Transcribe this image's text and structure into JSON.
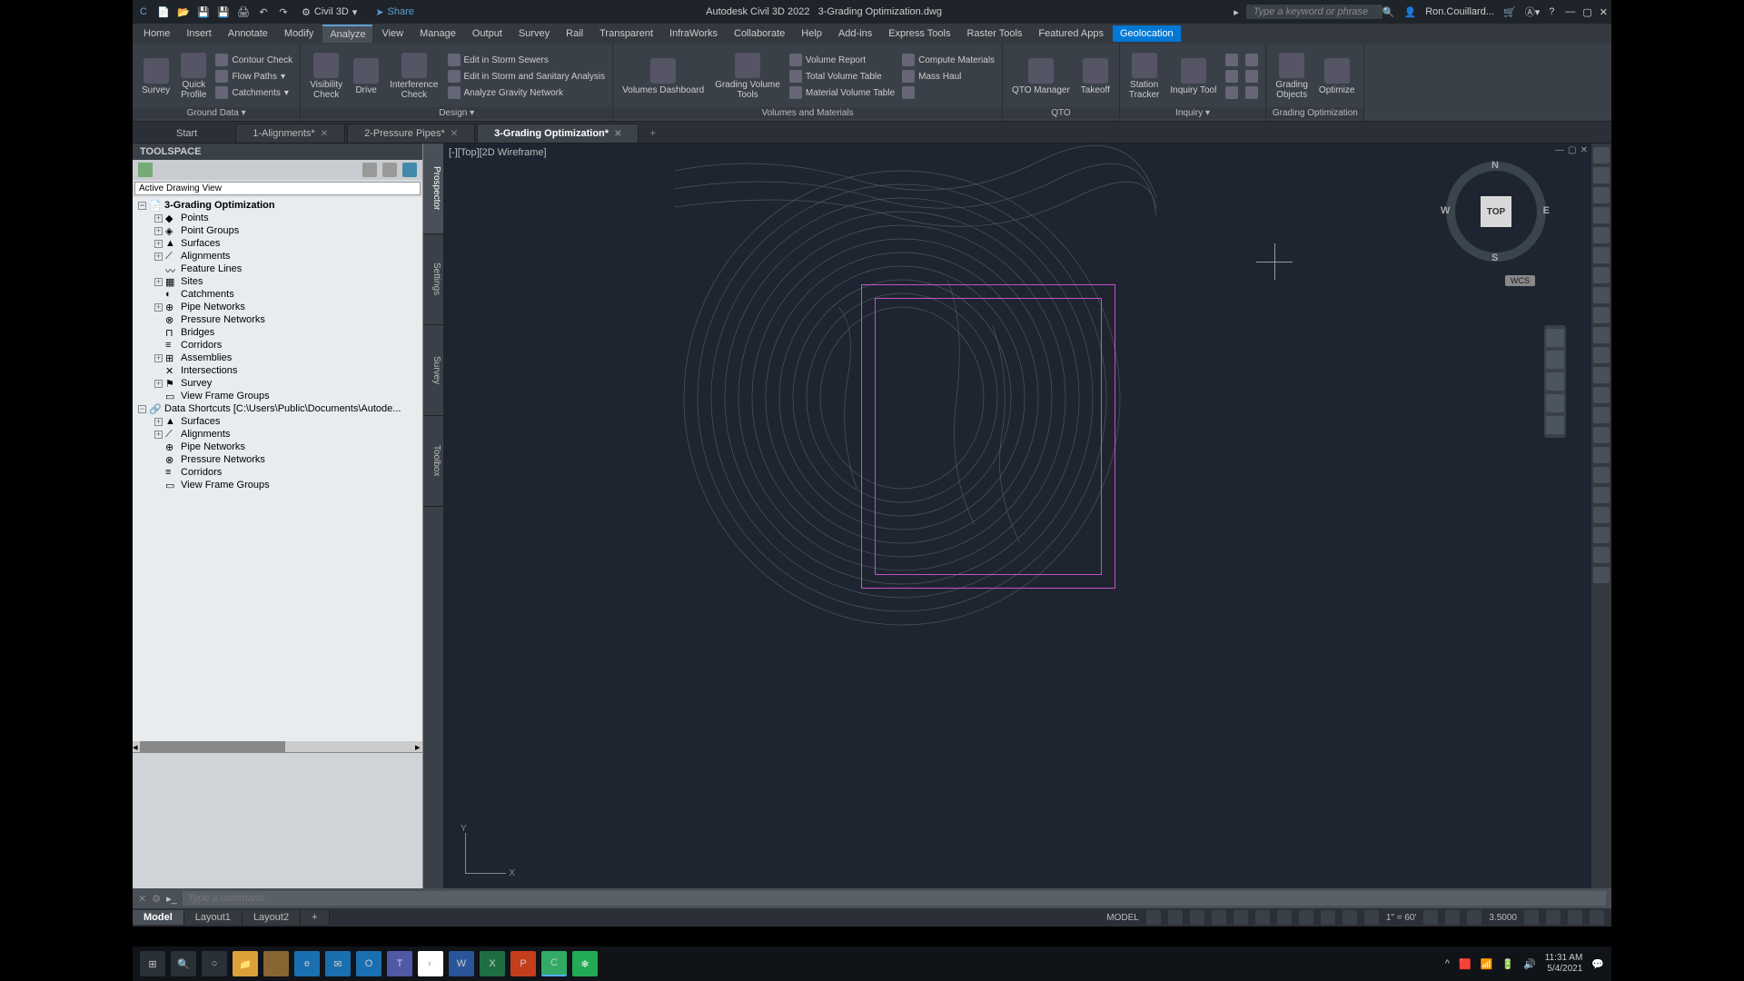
{
  "titlebar": {
    "workspace": "Civil 3D",
    "share": "Share",
    "app_title": "Autodesk Civil 3D 2022",
    "doc_title": "3-Grading Optimization.dwg",
    "search_placeholder": "Type a keyword or phrase",
    "user": "Ron.Couillard..."
  },
  "menubar": {
    "tabs": [
      {
        "label": "Home"
      },
      {
        "label": "Insert"
      },
      {
        "label": "Annotate"
      },
      {
        "label": "Modify"
      },
      {
        "label": "Analyze",
        "active": true
      },
      {
        "label": "View"
      },
      {
        "label": "Manage"
      },
      {
        "label": "Output"
      },
      {
        "label": "Survey"
      },
      {
        "label": "Rail"
      },
      {
        "label": "Transparent"
      },
      {
        "label": "InfraWorks"
      },
      {
        "label": "Collaborate"
      },
      {
        "label": "Help"
      },
      {
        "label": "Add-ins"
      },
      {
        "label": "Express Tools"
      },
      {
        "label": "Raster Tools"
      },
      {
        "label": "Featured Apps"
      },
      {
        "label": "Geolocation",
        "geo": true
      }
    ]
  },
  "ribbon": {
    "ground_data": {
      "survey": "Survey",
      "quick_profile": "Quick\nProfile",
      "contour_check": "Contour Check",
      "flow_paths": "Flow Paths",
      "catchments": "Catchments",
      "title": "Ground Data ▾"
    },
    "design": {
      "visibility_check": "Visibility\nCheck",
      "drive": "Drive",
      "interference_check": "Interference\nCheck",
      "storm_sewers": "Edit in Storm Sewers",
      "storm_sanitary": "Edit in Storm and Sanitary Analysis",
      "gravity_network": "Analyze Gravity Network",
      "title": "Design ▾"
    },
    "volumes": {
      "dashboard": "Volumes Dashboard",
      "grading_tools": "Grading Volume\nTools",
      "volume_report": "Volume Report",
      "total_volume": "Total Volume Table",
      "material_volume": "Material Volume Table",
      "compute_materials": "Compute Materials",
      "mass_haul": "Mass Haul",
      "title": "Volumes and Materials"
    },
    "qto": {
      "manager": "QTO Manager",
      "takeoff": "Takeoff",
      "title": "QTO"
    },
    "inquiry": {
      "station_tracker": "Station\nTracker",
      "inquiry_tool": "Inquiry Tool",
      "title": "Inquiry ▾"
    },
    "grading": {
      "grading_objects": "Grading\nObjects",
      "optimize": "Optimize",
      "title": "Grading Optimization"
    }
  },
  "doc_tabs": {
    "start": "Start",
    "tabs": [
      {
        "label": "1-Alignments*"
      },
      {
        "label": "2-Pressure Pipes*"
      },
      {
        "label": "3-Grading Optimization*",
        "active": true
      }
    ]
  },
  "toolspace": {
    "title": "TOOLSPACE",
    "view_dropdown": "Active Drawing View",
    "tree": [
      {
        "label": "3-Grading Optimization",
        "bold": true,
        "depth": 0,
        "exp": "−",
        "icon": "📄"
      },
      {
        "label": "Points",
        "depth": 1,
        "exp": "+",
        "icon": "◆"
      },
      {
        "label": "Point Groups",
        "depth": 1,
        "exp": "+",
        "icon": "◈"
      },
      {
        "label": "Surfaces",
        "depth": 1,
        "exp": "+",
        "icon": "▲"
      },
      {
        "label": "Alignments",
        "depth": 1,
        "exp": "+",
        "icon": "⟋"
      },
      {
        "label": "Feature Lines",
        "depth": 1,
        "exp": "",
        "icon": "〰"
      },
      {
        "label": "Sites",
        "depth": 1,
        "exp": "+",
        "icon": "▦"
      },
      {
        "label": "Catchments",
        "depth": 1,
        "exp": "",
        "icon": "◐"
      },
      {
        "label": "Pipe Networks",
        "depth": 1,
        "exp": "+",
        "icon": "⊕"
      },
      {
        "label": "Pressure Networks",
        "depth": 1,
        "exp": "",
        "icon": "⊗"
      },
      {
        "label": "Bridges",
        "depth": 1,
        "exp": "",
        "icon": "⊓"
      },
      {
        "label": "Corridors",
        "depth": 1,
        "exp": "",
        "icon": "≡"
      },
      {
        "label": "Assemblies",
        "depth": 1,
        "exp": "+",
        "icon": "⊞"
      },
      {
        "label": "Intersections",
        "depth": 1,
        "exp": "",
        "icon": "✕"
      },
      {
        "label": "Survey",
        "depth": 1,
        "exp": "+",
        "icon": "⚑"
      },
      {
        "label": "View Frame Groups",
        "depth": 1,
        "exp": "",
        "icon": "▭"
      },
      {
        "label": "Data Shortcuts [C:\\Users\\Public\\Documents\\Autode...",
        "depth": 0,
        "exp": "−",
        "icon": "🔗"
      },
      {
        "label": "Surfaces",
        "depth": 1,
        "exp": "+",
        "icon": "▲"
      },
      {
        "label": "Alignments",
        "depth": 1,
        "exp": "+",
        "icon": "⟋"
      },
      {
        "label": "Pipe Networks",
        "depth": 1,
        "exp": "",
        "icon": "⊕"
      },
      {
        "label": "Pressure Networks",
        "depth": 1,
        "exp": "",
        "icon": "⊗"
      },
      {
        "label": "Corridors",
        "depth": 1,
        "exp": "",
        "icon": "≡"
      },
      {
        "label": "View Frame Groups",
        "depth": 1,
        "exp": "",
        "icon": "▭"
      }
    ],
    "vtabs": [
      "Prospector",
      "Settings",
      "Survey",
      "Toolbox"
    ]
  },
  "viewport": {
    "label": "[-][Top][2D Wireframe]",
    "cube": {
      "face": "TOP",
      "n": "N",
      "s": "S",
      "e": "E",
      "w": "W"
    },
    "wcs": "WCS",
    "ucs": {
      "x": "X",
      "y": "Y"
    }
  },
  "cmdline": {
    "placeholder": "Type a command"
  },
  "layouts": {
    "tabs": [
      {
        "label": "Model",
        "active": true
      },
      {
        "label": "Layout1"
      },
      {
        "label": "Layout2"
      }
    ],
    "plus": "+"
  },
  "status": {
    "model": "MODEL",
    "scale": "1\" = 60'",
    "zoom": "3.5000"
  },
  "taskbar": {
    "time": "11:31 AM",
    "date": "5/4/2021"
  }
}
